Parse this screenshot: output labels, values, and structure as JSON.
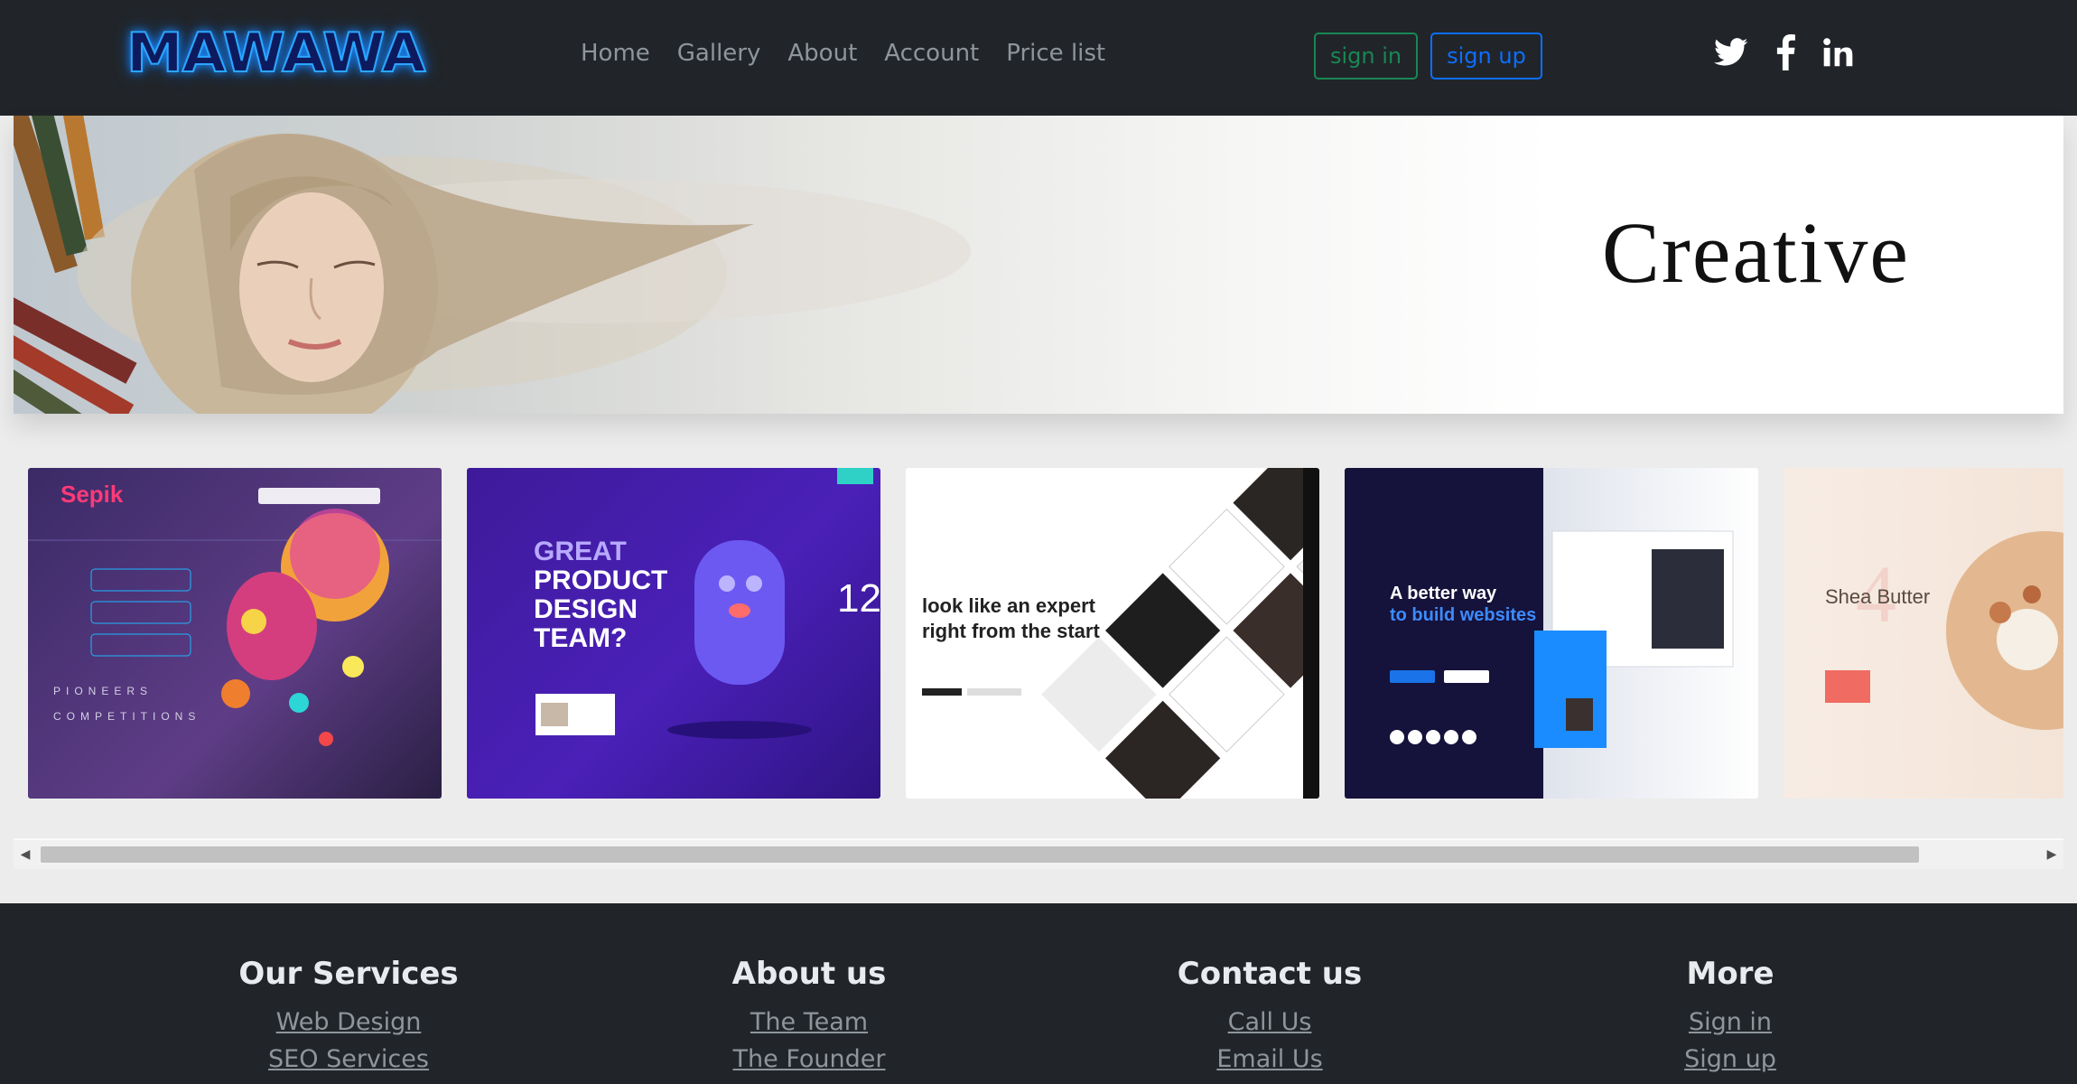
{
  "brand": {
    "logo": "MAWAWA"
  },
  "nav": {
    "links": [
      "Home",
      "Gallery",
      "About",
      "Account",
      "Price list"
    ],
    "signin_label": "sign in",
    "signup_label": "sign up",
    "social": [
      "twitter-icon",
      "facebook-icon",
      "linkedin-icon"
    ]
  },
  "hero": {
    "tagline": "Creative"
  },
  "gallery": {
    "cards": [
      {
        "lines": [
          "Sepik",
          "PIONEERS",
          "COMPETITIONS"
        ]
      },
      {
        "lines": [
          "GREAT",
          "PRODUCT",
          "DESIGN",
          "TEAM?",
          "12"
        ]
      },
      {
        "lines": [
          "look like an expert",
          "right from the start"
        ]
      },
      {
        "lines": [
          "A better way",
          "to build websites"
        ]
      },
      {
        "lines": [
          "Shea Butter"
        ]
      }
    ]
  },
  "footer": {
    "columns": [
      {
        "title": "Our Services",
        "links": [
          "Web Design",
          "SEO Services"
        ]
      },
      {
        "title": "About us",
        "links": [
          "The Team",
          "The Founder"
        ]
      },
      {
        "title": "Contact us",
        "links": [
          "Call Us",
          "Email Us"
        ]
      },
      {
        "title": "More",
        "links": [
          "Sign in",
          "Sign up"
        ]
      }
    ]
  },
  "colors": {
    "navbar_bg": "#212529",
    "signin_accent": "#198754",
    "signup_accent": "#0d6efd",
    "logo_glow": "#2aa6ff"
  }
}
